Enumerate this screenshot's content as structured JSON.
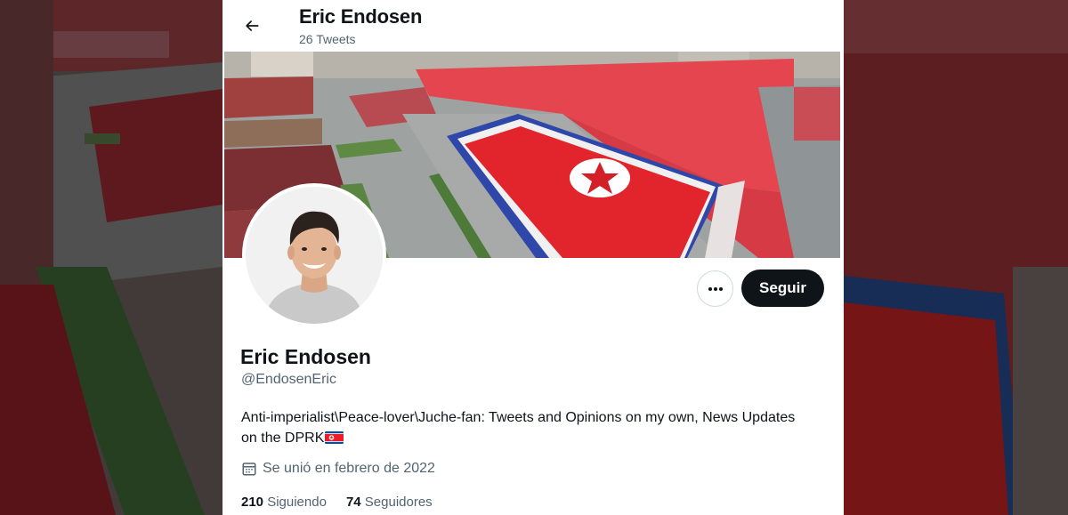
{
  "header": {
    "title": "Eric Endosen",
    "tweet_count": "26 Tweets",
    "back_icon": "arrow-left-icon"
  },
  "profile": {
    "display_name": "Eric Endosen",
    "handle": "@EndosenEric",
    "bio": "Anti-imperialist\\Peace-lover\\Juche-fan: Tweets and Opinions on my own, News Updates on the DPRK",
    "bio_emoji": "north-korea-flag-emoji",
    "joined": "Se unió en febrero de 2022",
    "joined_icon": "calendar-icon",
    "following_count": "210",
    "following_label": "Siguiendo",
    "followers_count": "74",
    "followers_label": "Seguidores"
  },
  "actions": {
    "more_icon": "more-horizontal-icon",
    "follow_label": "Seguir"
  },
  "colors": {
    "text_primary": "#0f1419",
    "text_secondary": "#536471",
    "follow_button_bg": "#0f1419",
    "border": "#cfd9de",
    "flag_red": "#ed1c27",
    "flag_blue": "#024fa2"
  }
}
